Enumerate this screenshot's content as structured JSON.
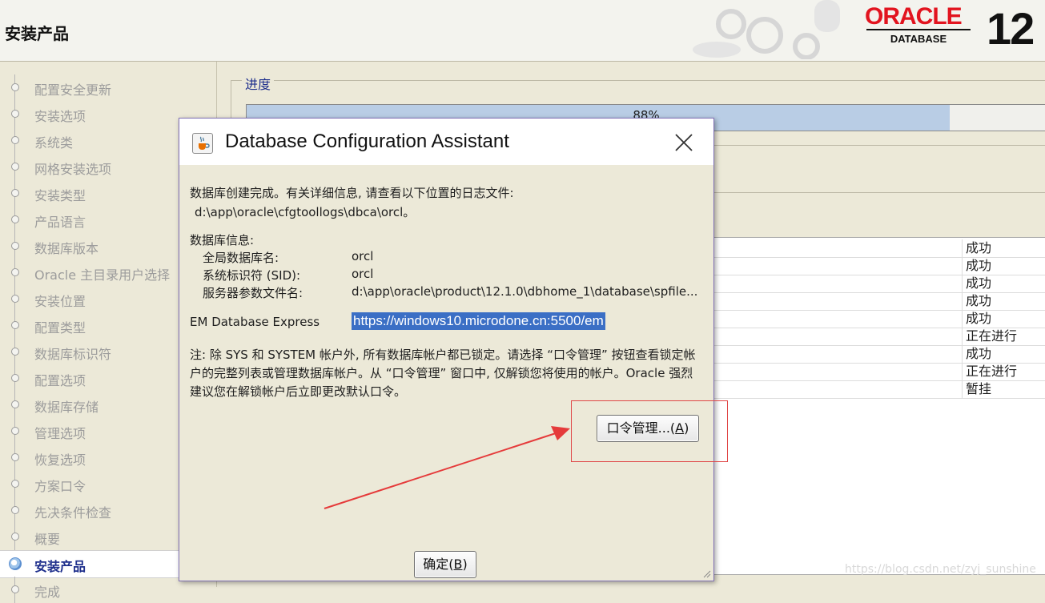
{
  "header": {
    "title": "安装产品",
    "brand": "ORACLE",
    "product": "DATABASE",
    "version": "12",
    "accent_color": "#e2141f"
  },
  "sidebar": {
    "steps": [
      {
        "label": "配置安全更新"
      },
      {
        "label": "安装选项"
      },
      {
        "label": "系统类"
      },
      {
        "label": "网格安装选项"
      },
      {
        "label": "安装类型"
      },
      {
        "label": "产品语言"
      },
      {
        "label": "数据库版本"
      },
      {
        "label": "Oracle 主目录用户选择"
      },
      {
        "label": "安装位置"
      },
      {
        "label": "配置类型"
      },
      {
        "label": "数据库标识符"
      },
      {
        "label": "配置选项"
      },
      {
        "label": "数据库存储"
      },
      {
        "label": "管理选项"
      },
      {
        "label": "恢复选项"
      },
      {
        "label": "方案口令"
      },
      {
        "label": "先决条件检查"
      },
      {
        "label": "概要"
      },
      {
        "label": "安装产品"
      },
      {
        "label": "完成"
      }
    ],
    "active_step": "安装产品"
  },
  "progress": {
    "legend": "进度",
    "percent_text": "88%",
    "value": 0.88
  },
  "status_list": [
    "成功",
    "成功",
    "成功",
    "成功",
    "成功",
    "正在进行",
    "成功",
    "正在进行",
    "暂挂"
  ],
  "dialog": {
    "title": "Database Configuration Assistant",
    "complete_msg": "数据库创建完成。有关详细信息, 请查看以下位置的日志文件:",
    "log_path": "d:\\app\\oracle\\cfgtoollogs\\dbca\\orcl。",
    "info_heading": "数据库信息:",
    "global_name_label": "全局数据库名:",
    "global_name_value": "orcl",
    "sid_label": "系统标识符 (SID):",
    "sid_value": "orcl",
    "spfile_label": "服务器参数文件名:",
    "spfile_value": "d:\\app\\oracle\\product\\12.1.0\\dbhome_1\\database\\spfile...",
    "em_label": "EM Database Express",
    "em_url": "https://windows10.microdone.cn:5500/em",
    "note": "注: 除 SYS 和 SYSTEM 帐户外, 所有数据库帐户都已锁定。请选择 “口令管理” 按钮查看锁定帐户的完整列表或管理数据库帐户。从 “口令管理” 窗口中, 仅解锁您将使用的帐户。Oracle 强烈建议您在解锁帐户后立即更改默认口令。",
    "pwd_button_text": "口令管理...(",
    "pwd_button_key": "A",
    "ok_button_text": "确定(",
    "ok_button_key": "B"
  },
  "watermark": "https://blog.csdn.net/zyj_sunshine"
}
